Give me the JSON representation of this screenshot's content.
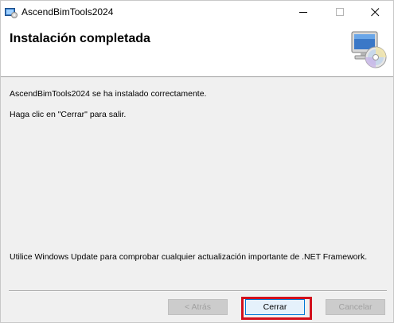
{
  "window": {
    "title": "AscendBimTools2024",
    "controls": {
      "minimize_icon": "minimize-icon",
      "maximize_icon": "maximize-icon",
      "close_icon": "close-icon"
    }
  },
  "header": {
    "title": "Instalación completada",
    "graphic_icon": "computer-cd-icon"
  },
  "messages": {
    "installed": "AscendBimTools2024 se ha instalado correctamente.",
    "exit_hint": "Haga clic en \"Cerrar\" para salir.",
    "windows_update": "Utilice Windows Update para comprobar cualquier actualización importante de .NET Framework."
  },
  "buttons": {
    "back": "< Atrás",
    "close": "Cerrar",
    "cancel": "Cancelar"
  },
  "colors": {
    "highlight": "#d2101c",
    "focus_border": "#0078d7"
  }
}
